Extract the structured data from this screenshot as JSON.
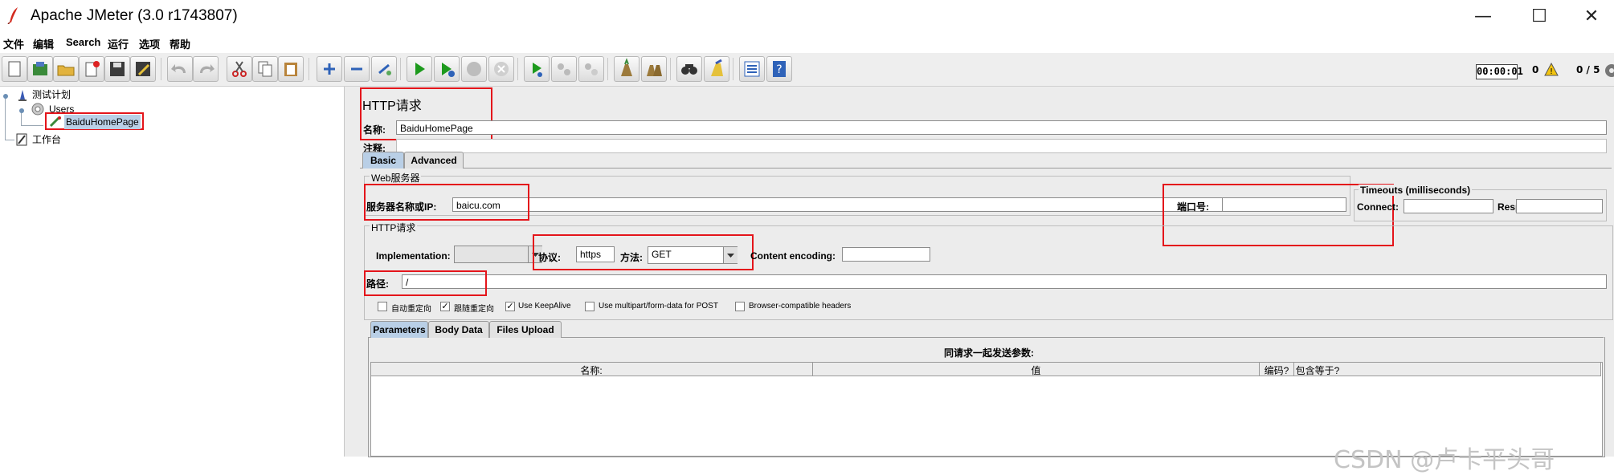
{
  "window": {
    "title": "Apache JMeter (3.0 r1743807)",
    "controls": {
      "minimize": "—",
      "maximize": "☐",
      "close": "✕"
    }
  },
  "menu": {
    "items": [
      {
        "label": "文件"
      },
      {
        "label": "编辑"
      },
      {
        "label": "Search"
      },
      {
        "label": "运行"
      },
      {
        "label": "选项"
      },
      {
        "label": "帮助"
      }
    ]
  },
  "toolbar": {
    "buttons": [
      {
        "icon": "new-icon"
      },
      {
        "icon": "templates-icon"
      },
      {
        "icon": "open-icon"
      },
      {
        "icon": "close-file-icon"
      },
      {
        "icon": "save-icon"
      },
      {
        "icon": "save-screenshot-icon"
      },
      {
        "icon": "undo-icon"
      },
      {
        "icon": "redo-icon"
      },
      {
        "icon": "cut-icon"
      },
      {
        "icon": "copy-icon"
      },
      {
        "icon": "paste-icon"
      },
      {
        "icon": "expand-icon"
      },
      {
        "icon": "collapse-icon"
      },
      {
        "icon": "toggle-icon"
      },
      {
        "icon": "start-icon"
      },
      {
        "icon": "start-no-pause-icon"
      },
      {
        "icon": "stop-icon"
      },
      {
        "icon": "shutdown-icon"
      },
      {
        "icon": "remote-start-icon"
      },
      {
        "icon": "remote-stop-icon"
      },
      {
        "icon": "remote-shutdown-icon"
      },
      {
        "icon": "clear-icon"
      },
      {
        "icon": "clear-all-icon"
      },
      {
        "icon": "search-icon"
      },
      {
        "icon": "reset-search-icon"
      },
      {
        "icon": "function-helper-icon"
      },
      {
        "icon": "help-icon"
      }
    ],
    "timer": "00:00:01",
    "warning_count": "0",
    "threads": "0 / 5"
  },
  "tree": {
    "items": [
      {
        "label": "测试计划"
      },
      {
        "label": "Users"
      },
      {
        "label": "BaiduHomePage"
      },
      {
        "label": "工作台"
      }
    ]
  },
  "sampler": {
    "title": "HTTP请求",
    "name_label": "名称:",
    "name_value": "BaiduHomePage",
    "comment_label": "注释:",
    "comment_value": "",
    "tabs": [
      {
        "label": "Basic"
      },
      {
        "label": "Advanced"
      }
    ],
    "web_server": {
      "group_title": "Web服务器",
      "server_label": "服务器名称或IP:",
      "server_value": "baicu.com",
      "port_label": "端口号:",
      "port_value": ""
    },
    "timeouts": {
      "group_title": "Timeouts (milliseconds)",
      "connect_label": "Connect:",
      "connect_value": "",
      "response_label": "Response:",
      "response_value": ""
    },
    "http_request": {
      "group_title": "HTTP请求",
      "implementation_label": "Implementation:",
      "implementation_value": "",
      "protocol_label": "协议:",
      "protocol_value": "https",
      "method_label": "方法:",
      "method_value": "GET",
      "encoding_label": "Content encoding:",
      "encoding_value": "",
      "path_label": "路径:",
      "path_value": "/"
    },
    "options": [
      {
        "label": "自动重定向",
        "checked": false
      },
      {
        "label": "跟随重定向",
        "checked": true
      },
      {
        "label": "Use KeepAlive",
        "checked": true
      },
      {
        "label": "Use multipart/form-data for POST",
        "checked": false
      },
      {
        "label": "Browser-compatible headers",
        "checked": false
      }
    ],
    "param_tabs": [
      {
        "label": "Parameters"
      },
      {
        "label": "Body Data"
      },
      {
        "label": "Files Upload"
      }
    ],
    "params_caption": "同请求一起发送参数:",
    "params_columns": [
      {
        "label": "名称:"
      },
      {
        "label": "值"
      },
      {
        "label": "编码?"
      },
      {
        "label": "包含等于?"
      }
    ]
  },
  "watermark": "CSDN @卢卡平头哥",
  "colors": {
    "highlight": "#e4151b",
    "tab_active": "#b9cfe6",
    "panel_bg": "#ececec"
  }
}
